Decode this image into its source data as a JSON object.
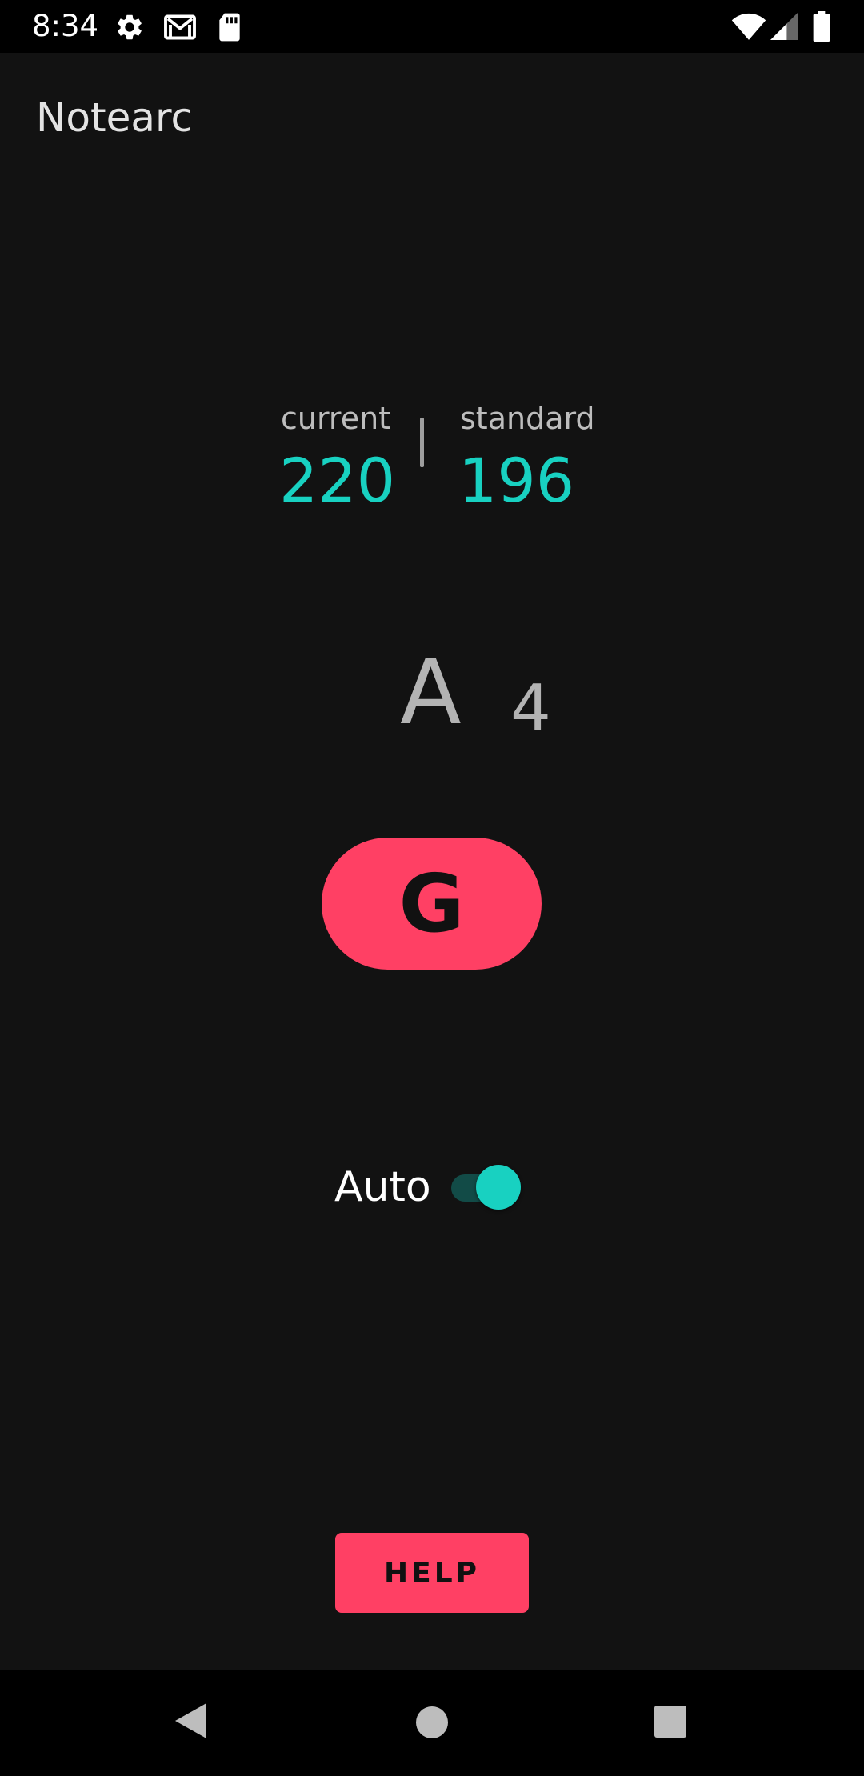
{
  "status_bar": {
    "time": "8:34",
    "left_icons": [
      "gear-icon",
      "gmail-icon",
      "sd-card-icon"
    ],
    "right_icons": [
      "wifi-icon",
      "cell-signal-icon",
      "battery-icon"
    ]
  },
  "app": {
    "title": "Notearc"
  },
  "tuner": {
    "current_label": "current",
    "current_value": "220",
    "standard_label": "standard",
    "standard_value": "196",
    "note_name": "A",
    "note_octave": "4"
  },
  "string_button": {
    "label": "G"
  },
  "auto_toggle": {
    "label": "Auto",
    "checked": true
  },
  "help_button": {
    "label": "HELP"
  },
  "nav_bar": {
    "icons": [
      "back-icon",
      "home-icon",
      "recents-icon"
    ]
  },
  "colors": {
    "background": "#121212",
    "accent": "#18d1c1",
    "button": "#ff4064",
    "bars": "#000000"
  }
}
